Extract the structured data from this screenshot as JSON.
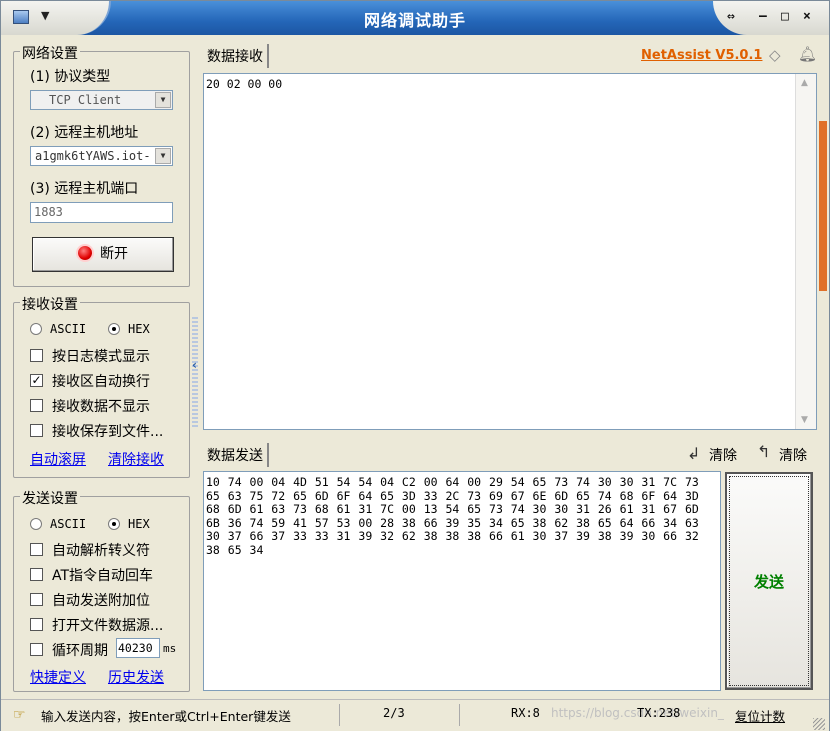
{
  "window": {
    "title": "网络调试助手",
    "menu_arrow": "▼",
    "pin_label": "⇔",
    "min_label": "–",
    "max_label": "□",
    "close_label": "×"
  },
  "brand": {
    "version_link": "NetAssist V5.0.1"
  },
  "network_settings": {
    "title": "网络设置",
    "protocol_label": "(1) 协议类型",
    "protocol_value": "TCP Client",
    "host_label": "(2) 远程主机地址",
    "host_value": "a1gmk6tYAWS.iot-",
    "port_label": "(3) 远程主机端口",
    "port_value": "1883",
    "connect_button": "断开"
  },
  "receive_settings": {
    "title": "接收设置",
    "ascii_label": "ASCII",
    "hex_label": "HEX",
    "hex_selected": true,
    "options": [
      {
        "label": "按日志模式显示",
        "checked": false
      },
      {
        "label": "接收区自动换行",
        "checked": true
      },
      {
        "label": "接收数据不显示",
        "checked": false
      },
      {
        "label": "接收保存到文件...",
        "checked": false
      }
    ],
    "auto_scroll_link": "自动滚屏",
    "clear_receive_link": "清除接收"
  },
  "send_settings": {
    "title": "发送设置",
    "ascii_label": "ASCII",
    "hex_label": "HEX",
    "hex_selected": true,
    "options": [
      {
        "label": "自动解析转义符",
        "checked": false
      },
      {
        "label": "AT指令自动回车",
        "checked": false
      },
      {
        "label": "自动发送附加位",
        "checked": false
      },
      {
        "label": "打开文件数据源...",
        "checked": false
      }
    ],
    "cycle_label": "循环周期",
    "cycle_value": "40230",
    "cycle_unit": "ms",
    "shortcut_link": "快捷定义",
    "history_link": "历史发送"
  },
  "receive_area": {
    "tab_label": "数据接收",
    "content": "20 02 00 00"
  },
  "send_area": {
    "tab_label": "数据发送",
    "clear1_label": "清除",
    "clear2_label": "清除",
    "content": "10 74 00 04 4D 51 54 54 04 C2 00 64 00 29 54 65 73 74 30 30 31 7C 73 65 63 75 72 65 6D 6F 64 65 3D 33 2C 73 69 67 6E 6D 65 74 68 6F 64 3D 68 6D 61 63 73 68 61 31 7C 00 13 54 65 73 74 30 30 31 26 61 31 67 6D 6B 36 74 59 41 57 53 00 28 38 66 39 35 34 65 38 62 38 65 64 66 34 63 30 37 66 37 33 33 31 39 32 62 38 38 38 66 61 30 37 39 38 39 30 66 32 38 65 34",
    "send_button": "发送"
  },
  "status_bar": {
    "hint": "输入发送内容，按Enter或Ctrl+Enter键发送",
    "page": "2/3",
    "rx": "RX:8",
    "watermark": "https://blog.csdn.net/weixin_",
    "tx": "TX:238",
    "reset_button": "复位计数"
  },
  "colors": {
    "accent": "#e06000",
    "send_text": "#008000",
    "title_bar": "#2466b8"
  }
}
